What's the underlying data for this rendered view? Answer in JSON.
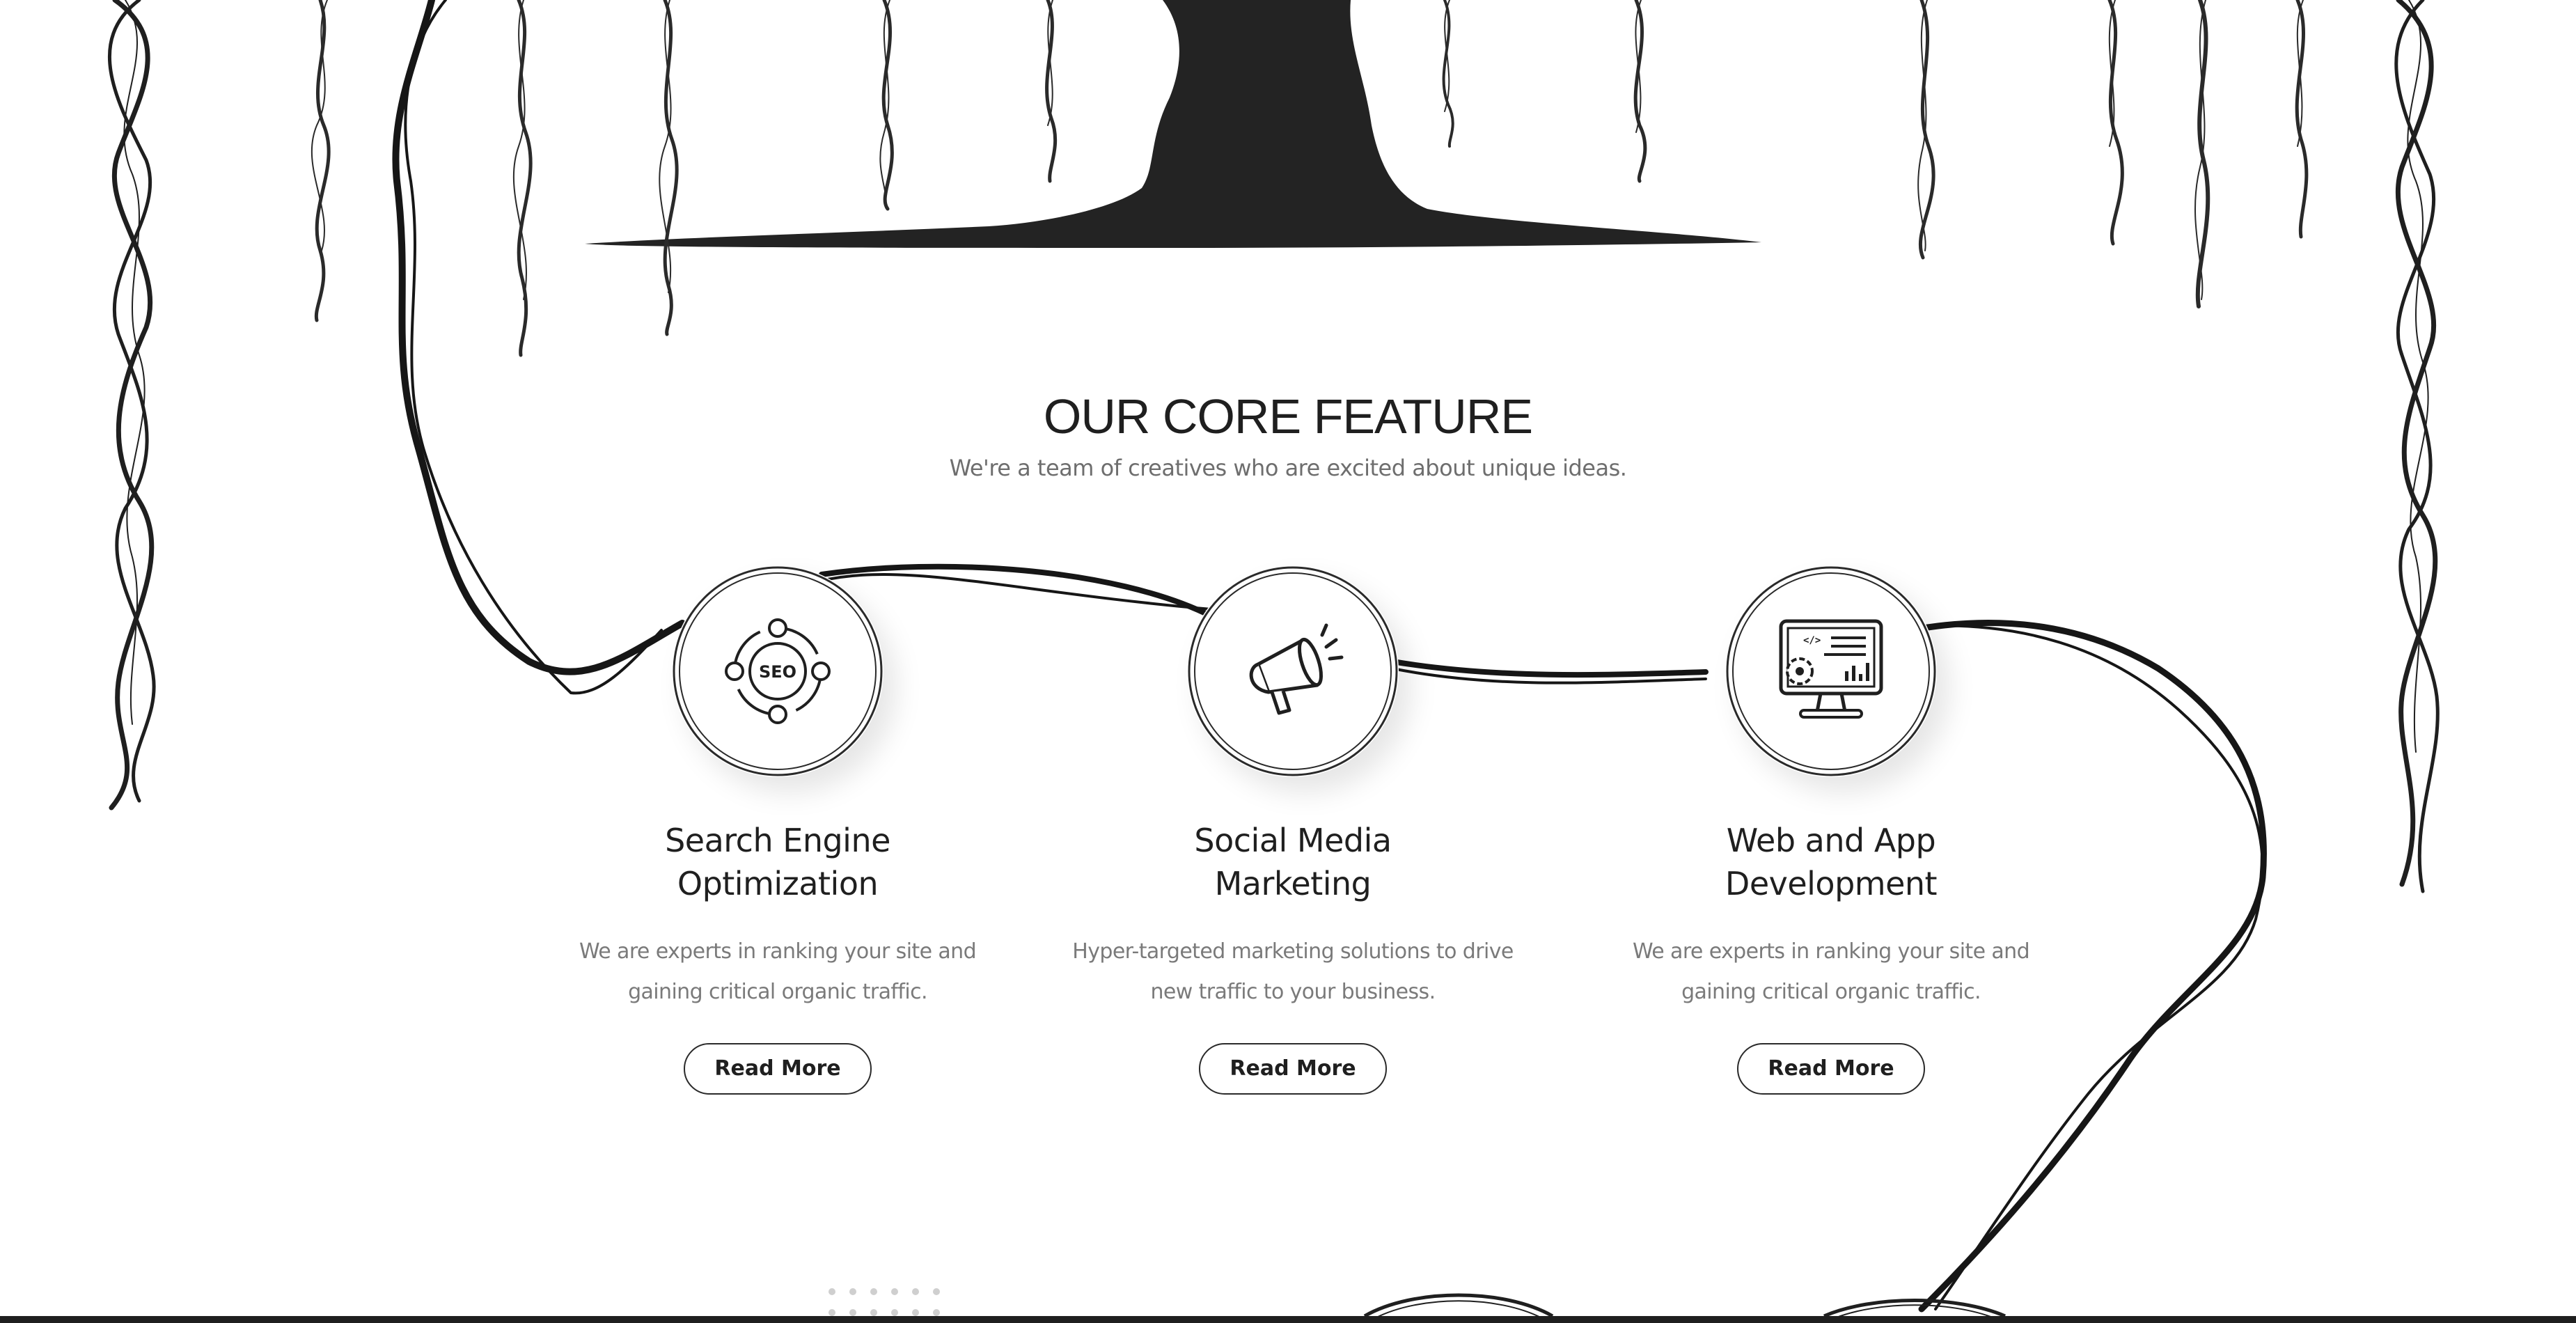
{
  "section": {
    "title": "OUR CORE FEATURE",
    "subtitle": "We're a team of creatives who are excited about unique ideas."
  },
  "features": [
    {
      "icon": "seo-icon",
      "icon_text": "SEO",
      "title_line1": "Search Engine",
      "title_line2": "Optimization",
      "desc_line1": "We are experts in ranking your site and",
      "desc_line2": "gaining critical organic traffic.",
      "button_label": "Read More"
    },
    {
      "icon": "megaphone-icon",
      "title_line1": "Social Media",
      "title_line2": "Marketing",
      "desc_line1": "Hyper-targeted marketing solutions to drive",
      "desc_line2": "new traffic to your business.",
      "button_label": "Read More"
    },
    {
      "icon": "monitor-code-icon",
      "title_line1": "Web and App",
      "title_line2": "Development",
      "desc_line1": "We are experts in ranking your site and",
      "desc_line2": "gaining critical organic traffic.",
      "button_label": "Read More"
    }
  ],
  "colors": {
    "ink": "#1f1f1f",
    "muted_text": "#7a7a7a",
    "background": "#ffffff"
  }
}
